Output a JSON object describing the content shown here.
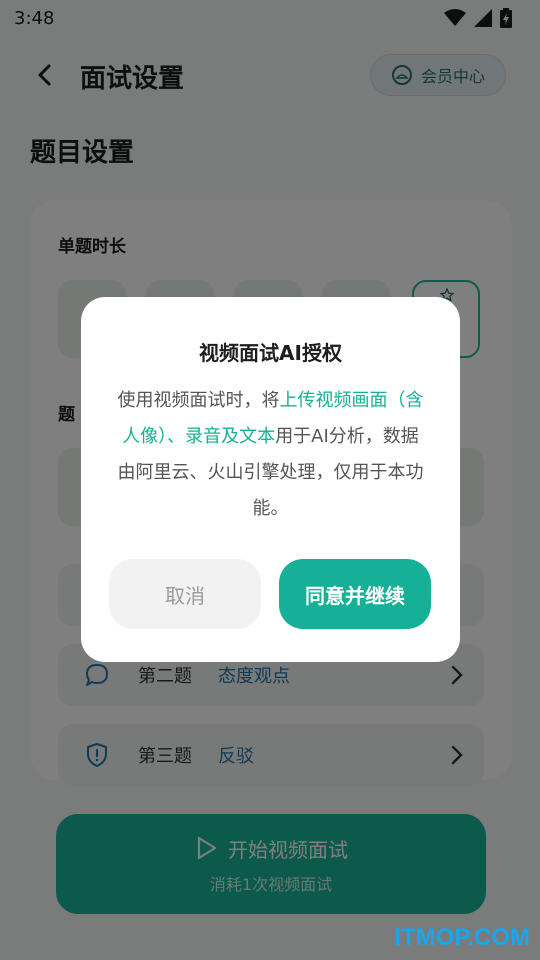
{
  "status_bar": {
    "time": "3:48"
  },
  "header": {
    "title": "面试设置",
    "member_center": "会员中心"
  },
  "section_title": "题目设置",
  "card": {
    "duration_label": "单题时长",
    "type_label": "题",
    "questions": [
      {
        "number": "第二题",
        "topic": "态度观点",
        "icon": "chat-bubble-icon"
      },
      {
        "number": "第三题",
        "topic": "反驳",
        "icon": "shield-icon"
      }
    ]
  },
  "start_button": {
    "label": "开始视频面试",
    "sub": "消耗1次视频面试"
  },
  "dialog": {
    "title": "视频面试AI授权",
    "body_prefix": "使用视频面试时，将",
    "body_highlight": "上传视频画面（含人像）、录音及文本",
    "body_suffix": "用于AI分析，数据由阿里云、火山引擎处理，仅用于本功能。",
    "cancel": "取消",
    "agree": "同意并继续"
  },
  "watermark": "ITMOP.COM",
  "colors": {
    "accent": "#16b096",
    "highlight": "#16b096",
    "topic": "#2277aa"
  }
}
